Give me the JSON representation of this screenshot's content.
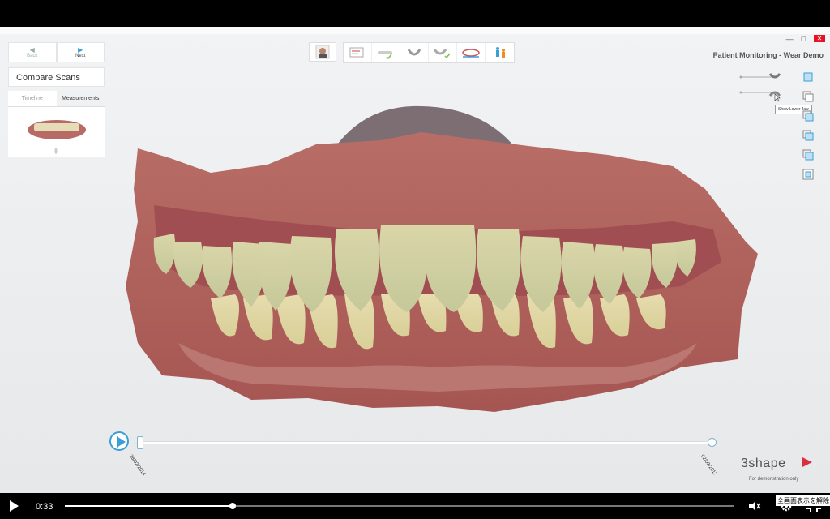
{
  "nav": {
    "back_label": "Back",
    "next_label": "Next"
  },
  "panel": {
    "title": "Compare Scans",
    "tabs": [
      "Timeline",
      "Measurements"
    ]
  },
  "app": {
    "title": "Patient Monitoring - Wear Demo"
  },
  "tooltip": {
    "show_lower_jaw": "Show Lower Jaw"
  },
  "timeline": {
    "start_date": "28/02/2014",
    "end_date": "02/03/2017"
  },
  "brand": {
    "logo": "3shape",
    "note": "For demonstration only"
  },
  "player": {
    "time": "0:33",
    "progress": 0.25,
    "fullscreen_tip": "全画面表示を解除"
  },
  "icons": {
    "toolbar": [
      "patient-photo-icon",
      "prescription-icon",
      "scanner-icon",
      "jaw-scan-icon",
      "bite-scan-icon",
      "compare-scans-icon",
      "patient-figure-icon"
    ],
    "right_tools": [
      "upper-jaw-view-icon",
      "lower-jaw-view-icon",
      "front-view-icon",
      "side-view-icon",
      "top-view-icon",
      "fit-view-icon"
    ]
  },
  "colors": {
    "accent": "#3a9fd6",
    "check": "#7cc245",
    "logo_red": "#d8303e",
    "close": "#e81123"
  }
}
